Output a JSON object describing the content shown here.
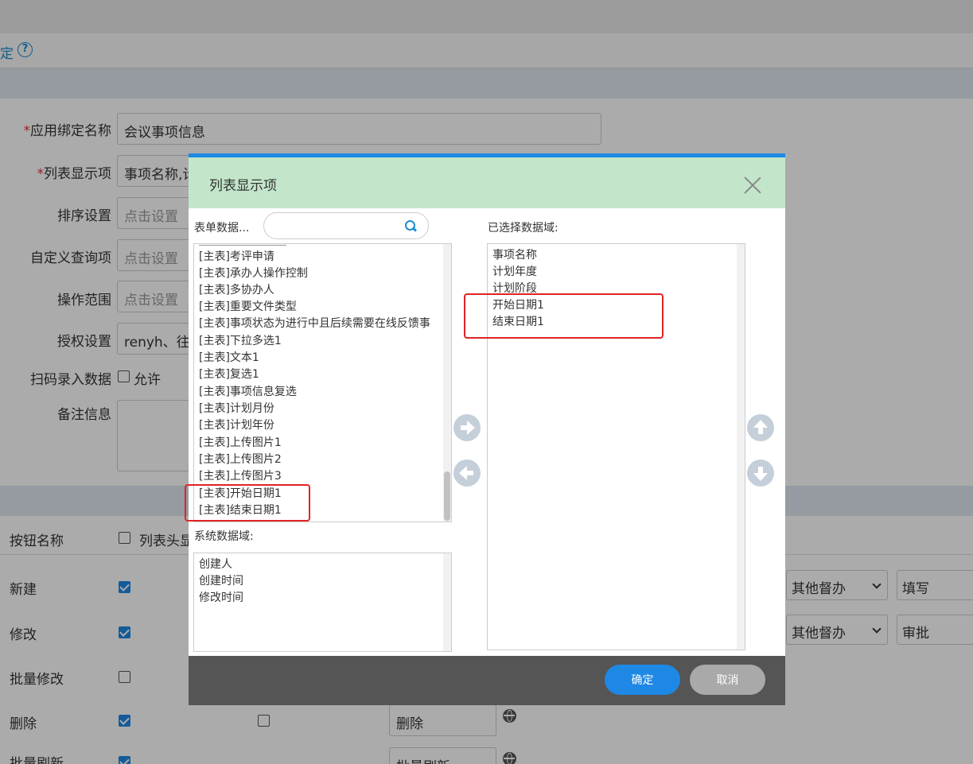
{
  "page": {
    "help_text": "定",
    "help_icon": "question-circle-icon",
    "form": {
      "app_bind_name": {
        "label": "应用绑定名称",
        "value": "会议事项信息"
      },
      "list_display": {
        "label": "列表显示项",
        "value": "事项名称,计"
      },
      "sort_setting": {
        "label": "排序设置",
        "placeholder": "点击设置"
      },
      "custom_query": {
        "label": "自定义查询项",
        "placeholder": "点击设置"
      },
      "op_scope": {
        "label": "操作范围",
        "placeholder": "点击设置"
      },
      "auth_setting": {
        "label": "授权设置",
        "value": "renyh、往"
      },
      "scan_entry": {
        "label": "扫码录入数据",
        "checkbox_label": "允许"
      },
      "remark": {
        "label": "备注信息"
      }
    },
    "required_mark": "*",
    "table": {
      "header": {
        "col1": "按钮名称",
        "col2": "列表头显"
      },
      "rows": [
        {
          "name": "新建",
          "checked": true,
          "select": "其他督办",
          "input": "填写"
        },
        {
          "name": "修改",
          "checked": true,
          "select": "其他督办",
          "input": "审批"
        },
        {
          "name": "批量修改",
          "checked": false
        },
        {
          "name": "删除",
          "checked": true,
          "input": "删除"
        },
        {
          "name": "批量刷新",
          "checked": true,
          "input": "批量刷新"
        }
      ]
    }
  },
  "dialog": {
    "title": "列表显示项",
    "form_fields_label": "表单数据...",
    "search_placeholder": "",
    "form_fields": [
      "[主表]考评申请",
      "[主表]承办人操作控制",
      "[主表]多协办人",
      "[主表]重要文件类型",
      "[主表]事项状态为进行中且后续需要在线反馈事",
      "[主表]下拉多选1",
      "[主表]文本1",
      "[主表]复选1",
      "[主表]事项信息复选",
      "[主表]计划月份",
      "[主表]计划年份",
      "[主表]上传图片1",
      "[主表]上传图片2",
      "[主表]上传图片3",
      "[主表]开始日期1",
      "[主表]结束日期1"
    ],
    "system_fields_label": "系统数据域:",
    "system_fields": [
      "创建人",
      "创建时间",
      "修改时间"
    ],
    "selected_label": "已选择数据域:",
    "selected_fields": [
      "事项名称",
      "计划年度",
      "计划阶段",
      "开始日期1",
      "结束日期1"
    ],
    "icons": {
      "add": "arrow-right-circle-icon",
      "remove": "arrow-left-circle-icon",
      "up": "arrow-up-circle-icon",
      "down": "arrow-down-circle-icon",
      "close": "close-icon",
      "search": "search-icon"
    },
    "buttons": {
      "ok": "确定",
      "cancel": "取消"
    },
    "colors": {
      "accent": "#1e88e5",
      "header_bg": "#c3e6ca",
      "highlight": "#e02424"
    }
  }
}
